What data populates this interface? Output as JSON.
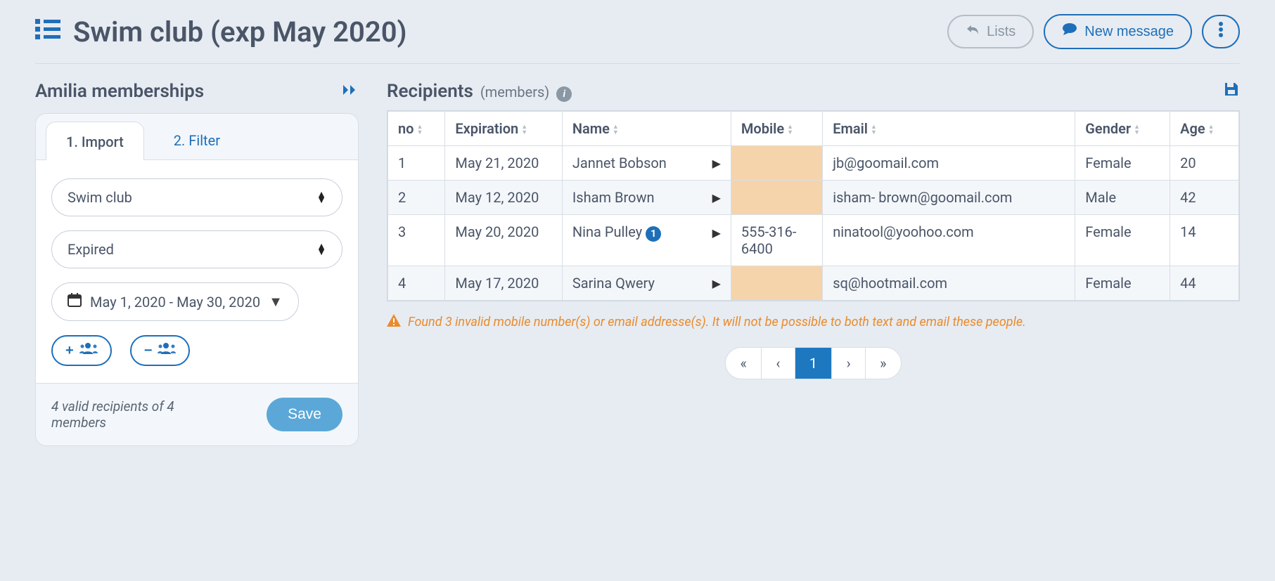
{
  "header": {
    "title": "Swim club (exp May 2020)",
    "lists_btn": "Lists",
    "new_message_btn": "New message"
  },
  "left": {
    "title": "Amilia memberships",
    "tabs": {
      "import": "1. Import",
      "filter": "2. Filter"
    },
    "membership_select": "Swim club",
    "status_select": "Expired",
    "date_range": "May 1, 2020 - May 30, 2020",
    "footer_status": "4 valid recipients of 4 members",
    "save_label": "Save"
  },
  "right": {
    "title": "Recipients",
    "subtitle": "(members)",
    "columns": [
      "no",
      "Expiration",
      "Name",
      "Mobile",
      "Email",
      "Gender",
      "Age"
    ],
    "rows": [
      {
        "no": "1",
        "expiration": "May 21, 2020",
        "name": "Jannet Bobson",
        "badge": null,
        "mobile": "",
        "email": "jb@goomail.com",
        "gender": "Female",
        "age": "20"
      },
      {
        "no": "2",
        "expiration": "May 12, 2020",
        "name": "Isham Brown",
        "badge": null,
        "mobile": "",
        "email": "isham- brown@goomail.com",
        "gender": "Male",
        "age": "42"
      },
      {
        "no": "3",
        "expiration": "May 20, 2020",
        "name": "Nina Pulley",
        "badge": "1",
        "mobile": "555-316-6400",
        "email": "ninatool@yoohoo.com",
        "gender": "Female",
        "age": "14"
      },
      {
        "no": "4",
        "expiration": "May 17, 2020",
        "name": "Sarina  Qwery",
        "badge": null,
        "mobile": "",
        "email": "sq@hootmail.com",
        "gender": "Female",
        "age": "44"
      }
    ],
    "warning": "Found 3 invalid mobile number(s) or email addresse(s). It will not be possible to both text and email these people.",
    "pagination": {
      "first": "«",
      "prev": "‹",
      "current": "1",
      "next": "›",
      "last": "»"
    }
  }
}
